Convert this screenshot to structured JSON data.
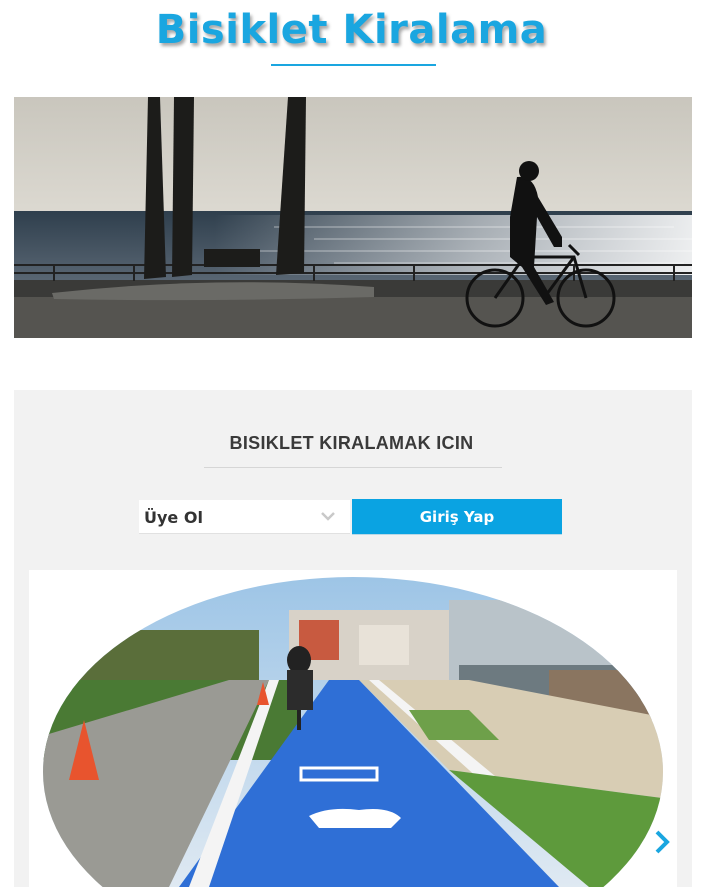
{
  "header": {
    "title": "Bisiklet Kiralama"
  },
  "hero": {
    "image_alt": "Deniz kenarında bisiklet süren kişi silüeti"
  },
  "rental": {
    "heading": "BISIKLET KIRALAMAK ICIN",
    "select": {
      "value": "Üye Ol"
    },
    "login_button": "Giriş Yap"
  },
  "slider": {
    "image_alt": "Mavi bisiklet yolunda bisiklet süren kişi",
    "next_icon": "chevron-right-icon"
  },
  "colors": {
    "accent": "#1aa6e0",
    "button": "#0aa3e2",
    "panel": "#f2f2f2"
  }
}
